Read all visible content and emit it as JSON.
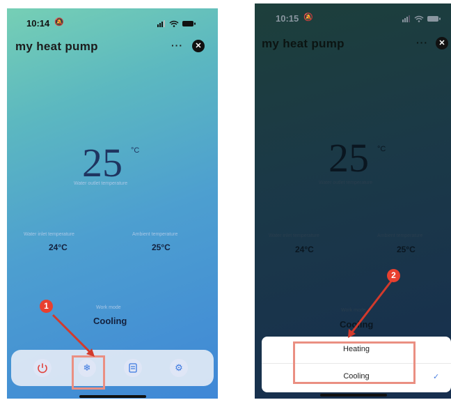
{
  "screen1": {
    "time": "10:14",
    "title": "my heat pump",
    "more": "···",
    "close": "✕",
    "main_temp": "25",
    "main_unit": "°C",
    "main_label": "Water outlet temperature",
    "inlet_label": "Water inlet temperature",
    "inlet_value": "24°C",
    "ambient_label": "Ambient temperature",
    "ambient_value": "25°C",
    "mode_label": "Work mode",
    "mode_value": "Cooling",
    "badge": "1",
    "icons": [
      "power-icon",
      "snowflake-icon",
      "document-icon",
      "settings-icon"
    ]
  },
  "screen2": {
    "time": "10:15",
    "title": "my heat pump",
    "more": "···",
    "close": "✕",
    "main_temp": "25",
    "main_unit": "°C",
    "main_label": "Water outlet temperature",
    "inlet_label": "Water inlet temperature",
    "inlet_value": "24°C",
    "ambient_label": "Ambient temperature",
    "ambient_value": "25°C",
    "mode_label": "Work mode",
    "mode_value": "Cooling",
    "badge": "2",
    "options": [
      "Heating",
      "Cooling"
    ],
    "selected_check": "✓"
  },
  "colors": {
    "callout": "#ea8f82",
    "badge": "#e8402f",
    "accent_check": "#4a7fe0",
    "power_red": "#e0403a"
  }
}
